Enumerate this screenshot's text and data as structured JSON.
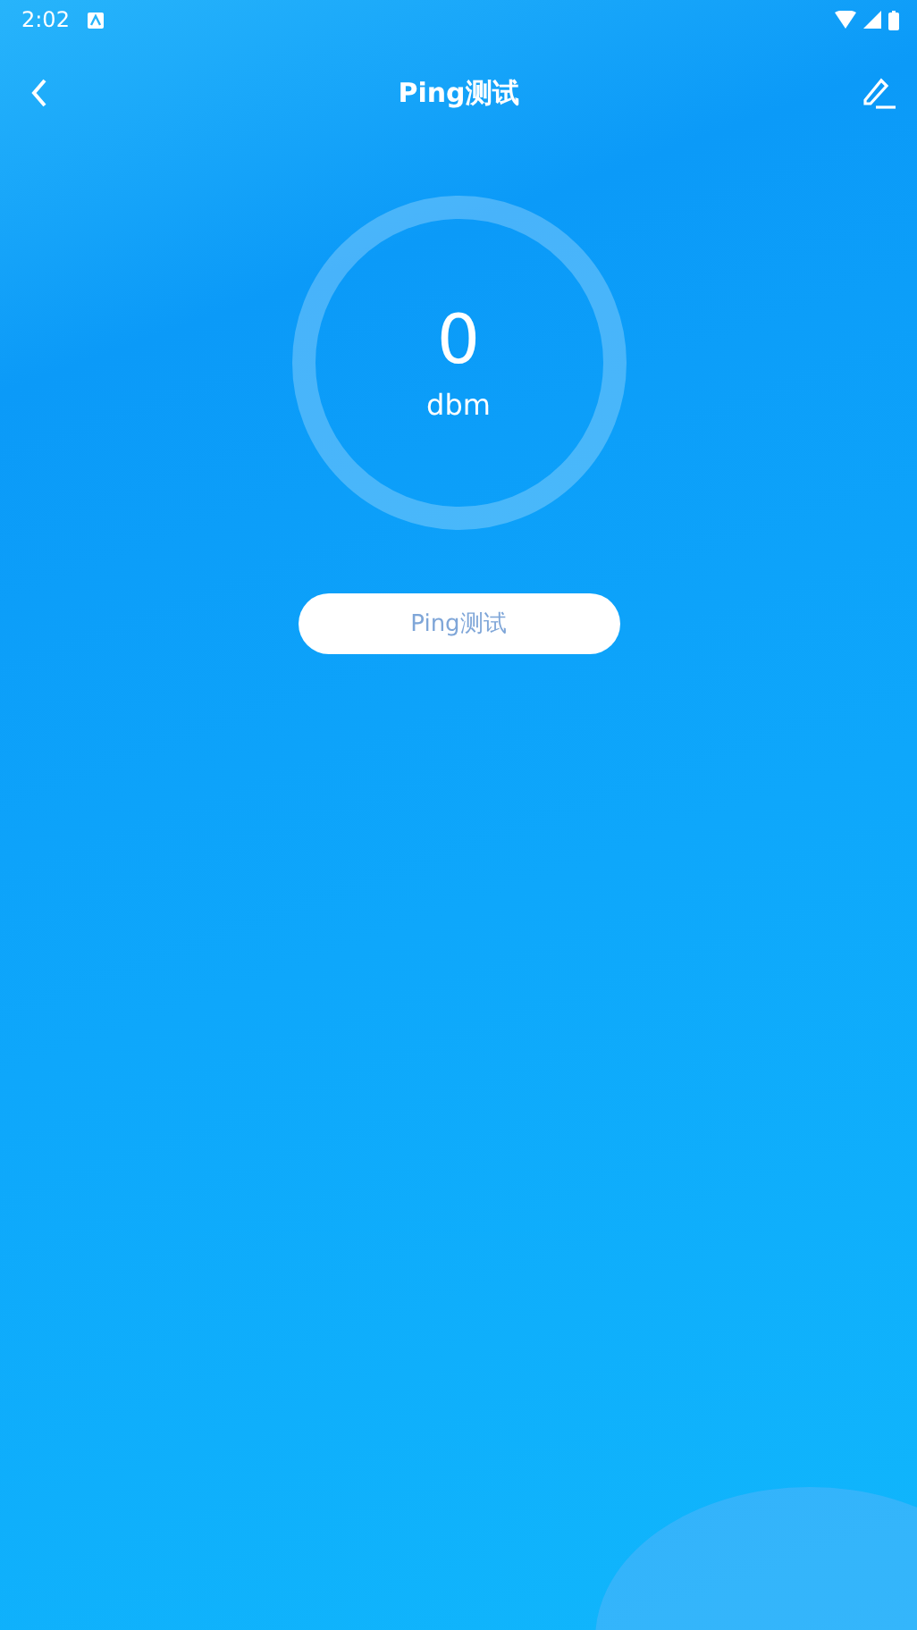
{
  "status_bar": {
    "time": "2:02"
  },
  "header": {
    "title": "Ping测试"
  },
  "gauge": {
    "value": "0",
    "unit": "dbm"
  },
  "action_button": {
    "label": "Ping测试"
  }
}
